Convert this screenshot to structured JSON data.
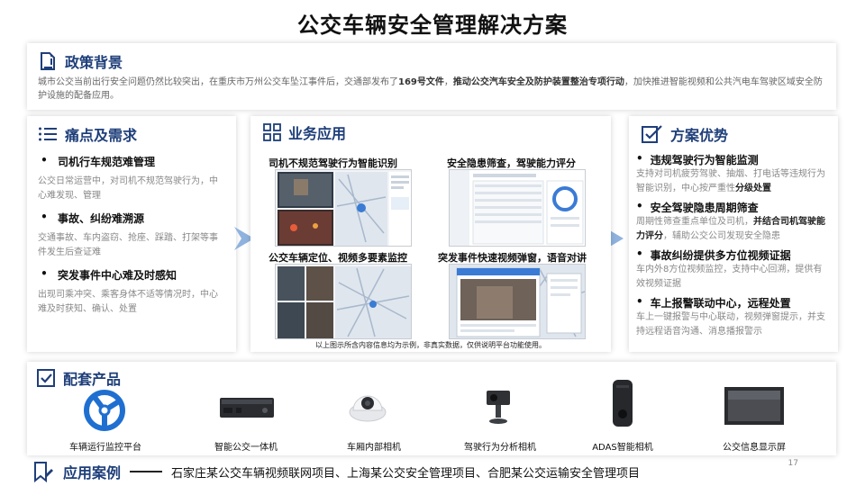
{
  "title": "公交车辆安全管理解决方案",
  "policy": {
    "heading": "政策背景",
    "text_before": "城市公交当前出行安全问题仍然比较突出，在重庆市万州公交车坠江事件后，交通部发布了",
    "bold1": "169号文件",
    "text_mid": "，",
    "bold2": "推动公交汽车安全及防护装置整治专项行动",
    "text_after": "，加快推进智能视频和公共汽电车驾驶区域安全防护设施的配备应用。"
  },
  "pain": {
    "heading": "痛点及需求",
    "items": [
      {
        "title": "司机行车规范难管理",
        "desc": "公交日常运营中，对司机不规范驾驶行为，中心难发现、管理"
      },
      {
        "title": "事故、纠纷难溯源",
        "desc": "交通事故、车内盗窃、抢座、踩踏、打架等事件发生后查证难"
      },
      {
        "title": "突发事件中心难及时感知",
        "desc": "出现司乘冲突、乘客身体不适等情况时，中心难及时获知、确认、处置"
      }
    ]
  },
  "biz": {
    "heading": "业务应用",
    "shots": [
      {
        "title": "司机不规范驾驶行为智能识别"
      },
      {
        "title": "安全隐患筛查，驾驶能力评分"
      },
      {
        "title": "公交车辆定位、视频多要素监控"
      },
      {
        "title": "突发事件快速视频弹窗，语音对讲"
      }
    ],
    "note": "以上图示所含内容信息均为示例，非真实数据，仅供说明平台功能使用。"
  },
  "adv": {
    "heading": "方案优势",
    "items": [
      {
        "title": "违规驾驶行为智能监测",
        "desc_plain": "支持对司机疲劳驾驶、抽烟、打电话等违规行为智能识别，中心按严重性",
        "desc_bold": "分级处置",
        "desc_tail": ""
      },
      {
        "title": "安全驾驶隐患周期筛查",
        "desc_plain": "周期性筛查重点单位及司机，",
        "desc_bold": "并结合司机驾驶能力评分",
        "desc_tail": "，辅助公交公司发现安全隐患"
      },
      {
        "title": "事故纠纷提供多方位视频证据",
        "desc_plain": "车内外8方位视频监控，支持中心回溯，提供有效视频证据",
        "desc_bold": "",
        "desc_tail": ""
      },
      {
        "title": "车上报警联动中心，远程处置",
        "desc_plain": "车上一键报警与中心联动，视频弹窗提示，并支持远程语音沟通、消息播报警示",
        "desc_bold": "",
        "desc_tail": ""
      }
    ]
  },
  "products": {
    "heading": "配套产品",
    "items": [
      {
        "label": "车辆运行监控平台",
        "icon": "platform-logo-icon"
      },
      {
        "label": "智能公交一体机",
        "icon": "dvr-device-icon"
      },
      {
        "label": "车厢内部相机",
        "icon": "dome-camera-icon"
      },
      {
        "label": "驾驶行为分析相机",
        "icon": "driver-camera-icon"
      },
      {
        "label": "ADAS智能相机",
        "icon": "adas-camera-icon"
      },
      {
        "label": "公交信息显示屏",
        "icon": "display-screen-icon"
      }
    ]
  },
  "cases": {
    "heading": "应用案例",
    "list": "石家庄某公交车辆视频联网项目、上海某公交安全管理项目、合肥某公交运输安全管理项目"
  },
  "page_number": "17",
  "colors": {
    "accent": "#1f3f7a",
    "arrow": "#8fb3de",
    "logo": "#1f6fd1"
  }
}
